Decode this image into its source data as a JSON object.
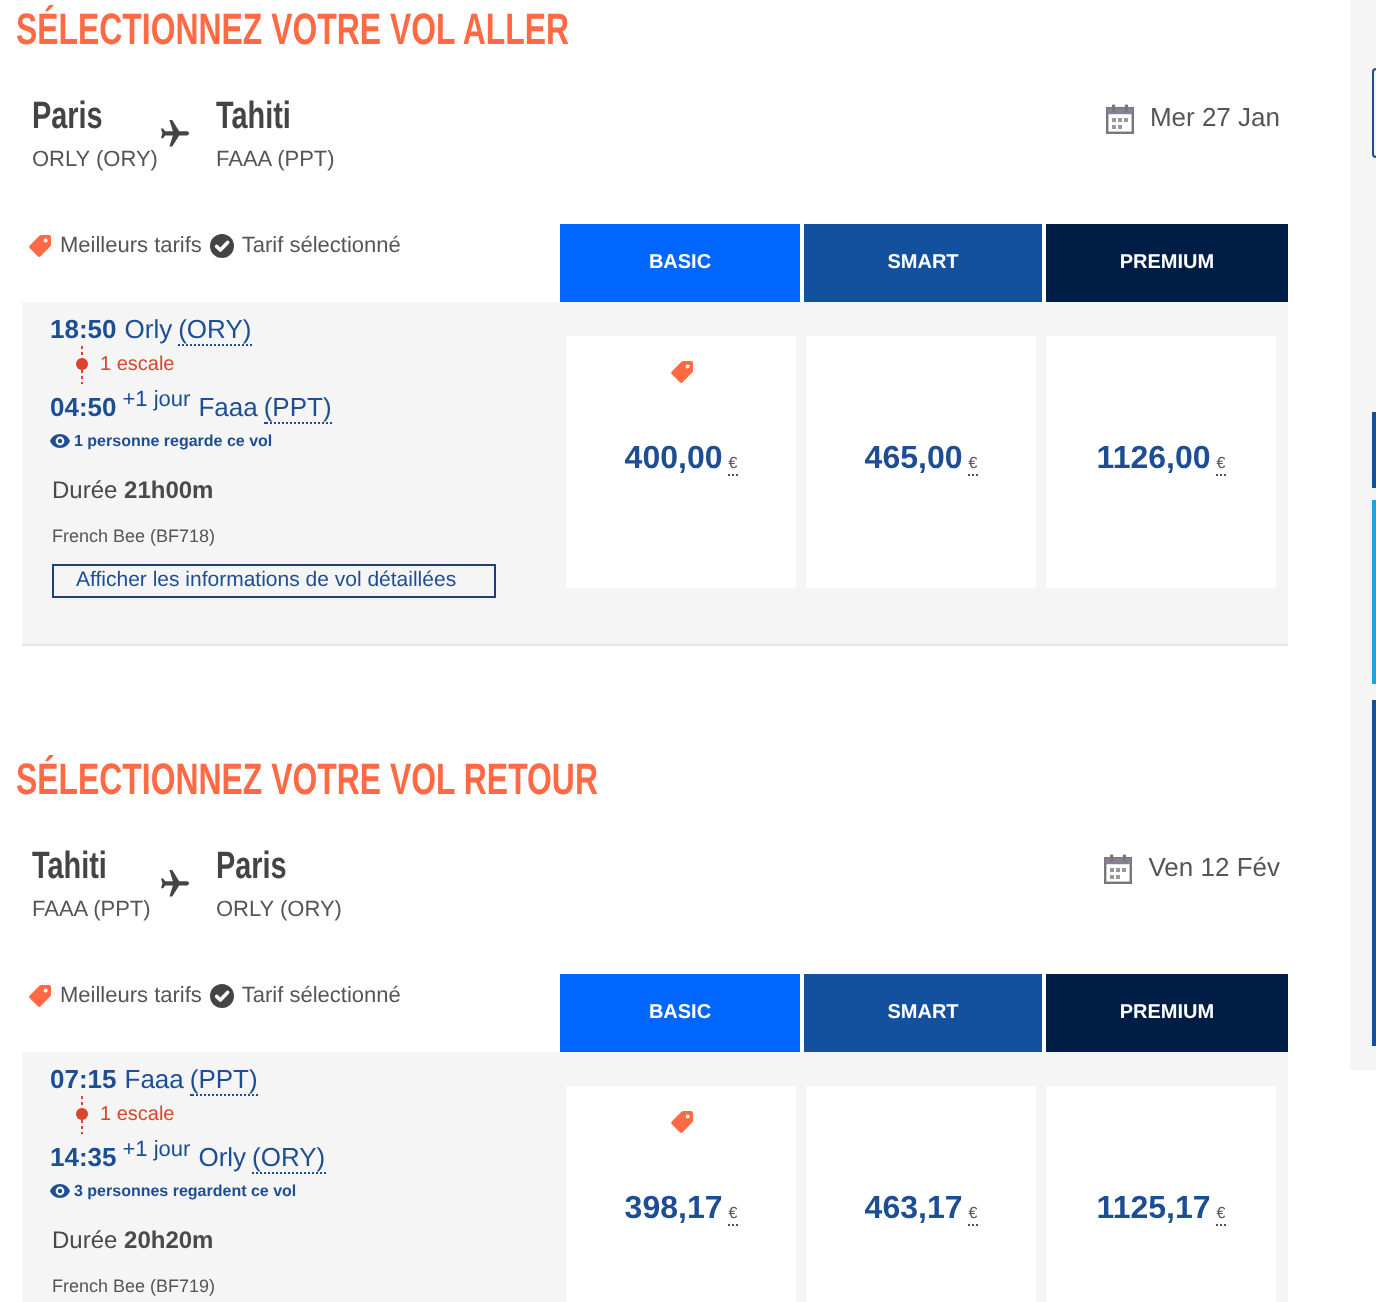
{
  "sections": [
    {
      "title": "SÉLECTIONNEZ VOTRE VOL ALLER",
      "route": {
        "origin": {
          "city": "Paris",
          "airport": "ORLY (ORY)"
        },
        "destination": {
          "city": "Tahiti",
          "airport": "FAAA (PPT)"
        }
      },
      "date": "Mer 27 Jan",
      "legend": [
        {
          "kind": "best_fare",
          "label": "Meilleurs tarifs"
        },
        {
          "kind": "selected_fare",
          "label": "Tarif sélectionné"
        }
      ],
      "fare_columns": [
        {
          "label": "BASIC",
          "color": "#0066ff"
        },
        {
          "label": "SMART",
          "color": "#13519e"
        },
        {
          "label": "PREMIUM",
          "color": "#001d45"
        }
      ],
      "flight": {
        "departure": {
          "time": "18:50",
          "airport": "Orly",
          "code": "(ORY)"
        },
        "stops": "1 escale",
        "arrival": {
          "time": "04:50",
          "day_offset": "+1 jour",
          "airport": "Faaa",
          "code": "(PPT)"
        },
        "watchers": "1 personne regarde ce vol",
        "duration": "Durée **21h00m**",
        "carrier": "French Bee (BF718)",
        "details_button": "Afficher les informations de vol détaillées"
      },
      "fares": [
        {
          "price": "400,00",
          "currency": "€",
          "best_fare": true
        },
        {
          "price": "465,00",
          "currency": "€",
          "best_fare": false
        },
        {
          "price": "1126,00",
          "currency": "€",
          "best_fare": false
        }
      ]
    },
    {
      "title": "SÉLECTIONNEZ VOTRE VOL RETOUR",
      "route": {
        "origin": {
          "city": "Tahiti",
          "airport": "FAAA (PPT)"
        },
        "destination": {
          "city": "Paris",
          "airport": "ORLY (ORY)"
        }
      },
      "date": "Ven 12 Fév",
      "legend": [
        {
          "kind": "best_fare",
          "label": "Meilleurs tarifs"
        },
        {
          "kind": "selected_fare",
          "label": "Tarif sélectionné"
        }
      ],
      "fare_columns": [
        {
          "label": "BASIC",
          "color": "#0066ff"
        },
        {
          "label": "SMART",
          "color": "#13519e"
        },
        {
          "label": "PREMIUM",
          "color": "#001d45"
        }
      ],
      "flight": {
        "departure": {
          "time": "07:15",
          "airport": "Faaa",
          "code": "(PPT)"
        },
        "stops": "1 escale",
        "arrival": {
          "time": "14:35",
          "day_offset": "+1 jour",
          "airport": "Orly",
          "code": "(ORY)"
        },
        "watchers": "3 personnes regardent ce vol",
        "duration": "Durée **20h20m**",
        "carrier": "French Bee (BF719)"
      },
      "fares": [
        {
          "price": "398,17",
          "currency": "€",
          "best_fare": true
        },
        {
          "price": "463,17",
          "currency": "€",
          "best_fare": false
        },
        {
          "price": "1125,17",
          "currency": "€",
          "best_fare": false
        }
      ]
    }
  ]
}
